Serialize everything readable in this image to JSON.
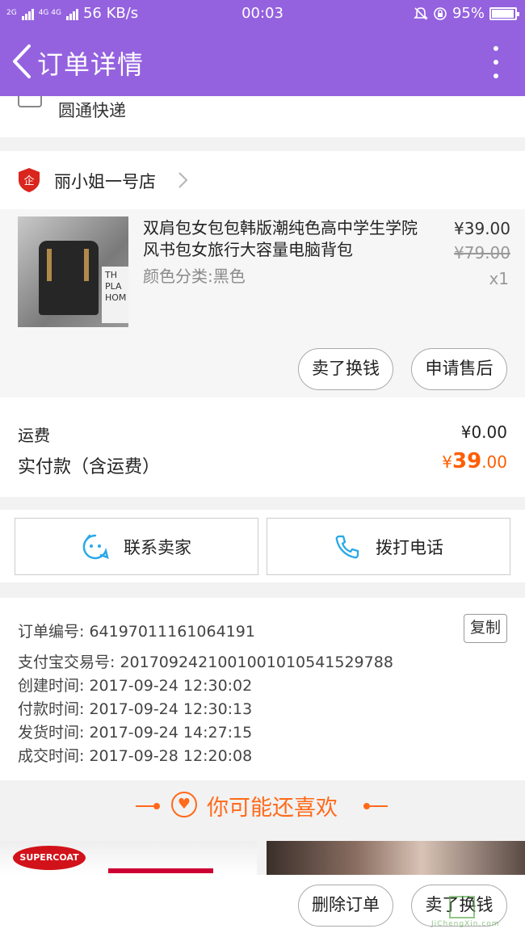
{
  "status_bar": {
    "network_left": "2G",
    "network_mid": "4G 4G",
    "speed": "56 KB/s",
    "time": "00:03",
    "battery": "95%",
    "battery_level": 0.95
  },
  "header": {
    "title": "订单详情"
  },
  "logistics": {
    "carrier": "圆通快递"
  },
  "shop": {
    "name": "丽小姐一号店",
    "logo_char": "企"
  },
  "product": {
    "title": "双肩包女包包韩版潮纯色高中学生学院风书包女旅行大容量电脑背包",
    "attribute": "颜色分类:黑色",
    "price": "¥39.00",
    "original_price": "¥79.00",
    "quantity": "x1",
    "thumbnail_text": "TH PLA HOM",
    "buttons": {
      "resell": "卖了换钱",
      "after_sale": "申请售后"
    }
  },
  "fees": {
    "shipping_label": "运费",
    "shipping_value": "¥0.00",
    "paid_label": "实付款（含运费）",
    "paid_symbol": "¥",
    "paid_integer": "39",
    "paid_decimal": ".00"
  },
  "actions": {
    "contact_seller": "联系卖家",
    "call": "拨打电话"
  },
  "order_info": {
    "copy_button": "复制",
    "rows": [
      "订单编号: 64197011161064191",
      "支付宝交易号: 2017092421001001010541529788",
      "创建时间: 2017-09-24 12:30:02",
      "付款时间: 2017-09-24 12:30:13",
      "发货时间: 2017-09-24 14:27:15",
      "成交时间: 2017-09-28 12:20:08"
    ]
  },
  "recommend": {
    "title": "你可能还喜欢",
    "item1_brand": "SUPERCOAT"
  },
  "bottom": {
    "delete_order": "删除订单",
    "resell": "卖了换钱",
    "watermark": "JiChengXin.com"
  },
  "colors": {
    "primary": "#9462df",
    "accent": "#ff5d00",
    "link_blue": "#29a9e8"
  }
}
